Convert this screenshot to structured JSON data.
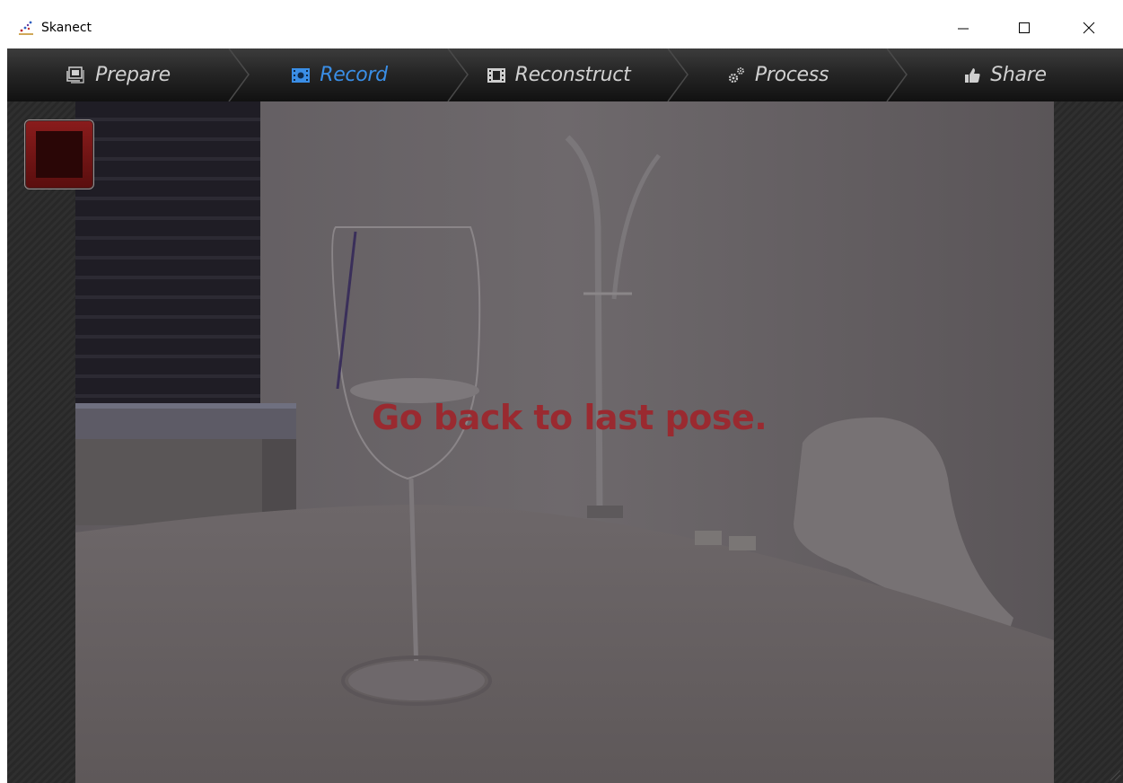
{
  "window": {
    "title": "Skanect"
  },
  "window_controls": {
    "minimize_icon": "minimize-icon",
    "maximize_icon": "maximize-icon",
    "close_icon": "close-icon"
  },
  "tabs": [
    {
      "label": "Prepare",
      "icon": "images-icon",
      "active": false
    },
    {
      "label": "Record",
      "icon": "film-record-icon",
      "active": true
    },
    {
      "label": "Reconstruct",
      "icon": "film-icon",
      "active": false
    },
    {
      "label": "Process",
      "icon": "gears-icon",
      "active": false
    },
    {
      "label": "Share",
      "icon": "thumbs-up-icon",
      "active": false
    }
  ],
  "recording": {
    "stop_button_icon": "stop-icon",
    "status_message": "Go back to last pose."
  },
  "colors": {
    "active_tab": "#3a8ee6",
    "inactive_tab": "#d0d0d0",
    "warning": "#9a2a30",
    "stop_button": "#7a1616"
  }
}
